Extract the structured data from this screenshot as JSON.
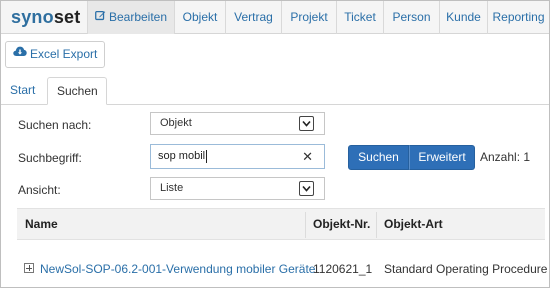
{
  "brand": {
    "part1": "syno",
    "part2": "set"
  },
  "nav": {
    "tabs": [
      {
        "label": "Bearbeiten",
        "icon": "edit-icon",
        "active": true
      },
      {
        "label": "Objekt"
      },
      {
        "label": "Vertrag"
      },
      {
        "label": "Projekt"
      },
      {
        "label": "Ticket"
      },
      {
        "label": "Person"
      },
      {
        "label": "Kunde"
      },
      {
        "label": "Reporting"
      }
    ]
  },
  "toolbar": {
    "excel_label": "Excel Export",
    "excel_icon": "cloud-download-icon"
  },
  "subtabs": [
    {
      "label": "Start",
      "active": false
    },
    {
      "label": "Suchen",
      "active": true
    }
  ],
  "form": {
    "search_for_label": "Suchen nach:",
    "search_for_value": "Objekt",
    "term_label": "Suchbegriff:",
    "term_value": "sop mobil",
    "clear_symbol": "✕",
    "view_label": "Ansicht:",
    "view_value": "Liste",
    "search_button": "Suchen",
    "advanced_button": "Erweitert",
    "count_label": "Anzahl: 1"
  },
  "table": {
    "columns": [
      "Name",
      "Objekt-Nr.",
      "Objekt-Art"
    ],
    "rows": [
      {
        "name": "NewSol-SOP-06.2-001-Verwendung mobiler Geräte",
        "number": "1120621_1",
        "type": "Standard Operating Procedure"
      }
    ]
  },
  "colors": {
    "accent": "#2a6fa8",
    "button_primary": "#2e6fb7",
    "header_bg": "#f2f2f2"
  }
}
